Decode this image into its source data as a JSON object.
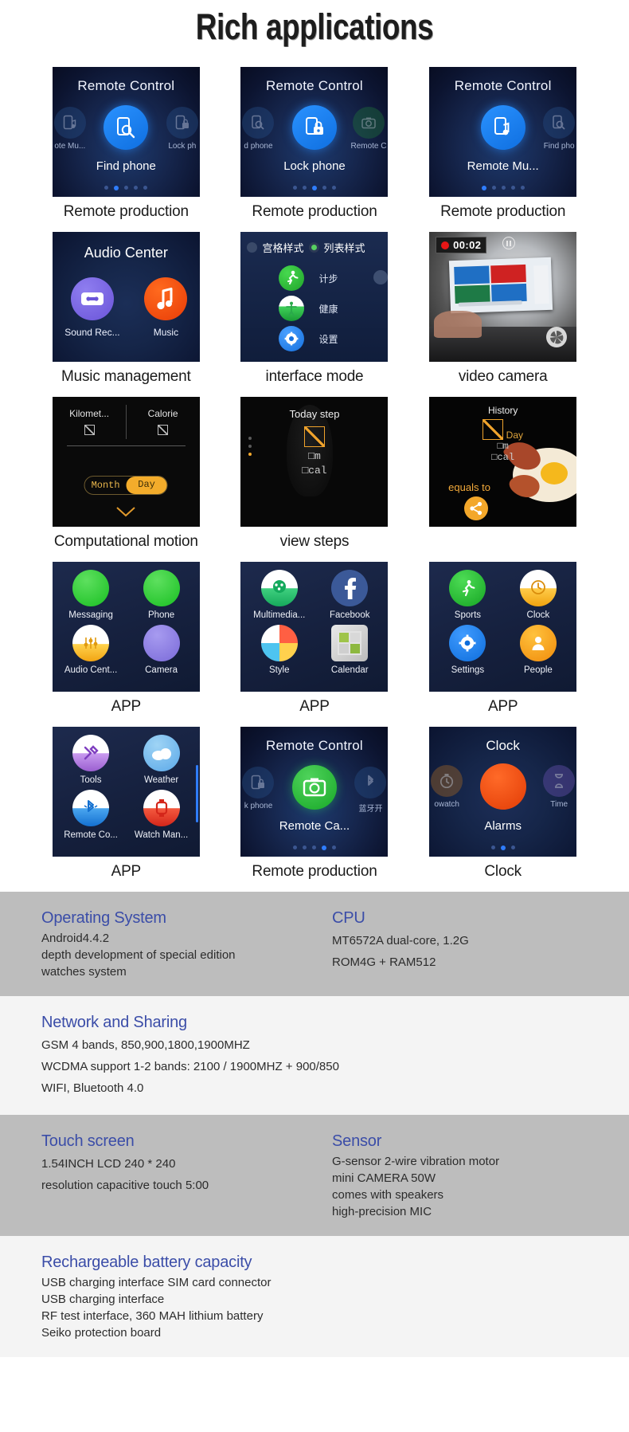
{
  "page": {
    "title": "Rich applications"
  },
  "cards": [
    {
      "caption": "Remote production",
      "screen_title": "Remote Control",
      "main_label": "Find phone",
      "left_label": "ote Mu...",
      "right_label": "Lock ph",
      "dots": 5,
      "active_dot": 2,
      "left_icon": "music-phone-icon",
      "main_icon": "find-phone-icon",
      "right_icon": "lock-phone-icon"
    },
    {
      "caption": "Remote production",
      "screen_title": "Remote Control",
      "main_label": "Lock phone",
      "left_label": "d phone",
      "right_label": "Remote C",
      "dots": 5,
      "active_dot": 3,
      "left_icon": "find-phone-icon",
      "main_icon": "lock-phone-icon",
      "right_icon": "remote-camera-icon"
    },
    {
      "caption": "Remote production",
      "screen_title": "Remote Control",
      "main_label": "Remote Mu...",
      "left_label": "",
      "right_label": "Find pho",
      "dots": 5,
      "active_dot": 1,
      "left_icon": "none-icon",
      "main_icon": "music-phone-icon",
      "right_icon": "find-phone-icon"
    },
    {
      "caption": "Music management",
      "screen_title": "Audio Center",
      "items": [
        {
          "label": "Sound Rec...",
          "icon": "cassette-icon"
        },
        {
          "label": "Music",
          "icon": "music-note-icon"
        }
      ]
    },
    {
      "caption": "interface mode",
      "radios": [
        {
          "label": "宫格样式",
          "selected": false
        },
        {
          "label": "列表样式",
          "selected": true
        }
      ],
      "rows": [
        {
          "label": "计步",
          "icon": "running-icon"
        },
        {
          "label": "健康",
          "icon": "health-icon"
        },
        {
          "label": "设置",
          "icon": "settings-gear-icon"
        }
      ]
    },
    {
      "caption": "video camera",
      "timer": "00:02",
      "rec_icon": "record-dot-icon",
      "pause_icon": "pause-icon",
      "shutter_icon": "shutter-icon"
    },
    {
      "caption": "Computational motion",
      "cols": [
        {
          "label": "Kilomet...",
          "value": "□"
        },
        {
          "label": "Calorie",
          "value": "□"
        }
      ],
      "toggle": [
        "Month",
        "Day"
      ],
      "toggle_active": "Day",
      "chevron": "chevron-down-icon"
    },
    {
      "caption": "view steps",
      "title": "Today step",
      "value": "□",
      "sub1": "□m",
      "sub2": "□cal"
    },
    {
      "caption": "",
      "title": "History",
      "day_label": "Day",
      "v1": "□",
      "v2": "□m",
      "v3": "□cal",
      "equals": "equals to",
      "share_icon": "share-icon"
    },
    {
      "caption": "APP",
      "apps": [
        {
          "label": "Messaging",
          "icon": "messaging-icon"
        },
        {
          "label": "Phone",
          "icon": "phone-icon"
        },
        {
          "label": "Audio Cent...",
          "icon": "audio-center-icon"
        },
        {
          "label": "Camera",
          "icon": "camera-icon"
        }
      ]
    },
    {
      "caption": "APP",
      "apps": [
        {
          "label": "Multimedia...",
          "icon": "multimedia-icon"
        },
        {
          "label": "Facebook",
          "icon": "facebook-icon"
        },
        {
          "label": "Style",
          "icon": "style-icon"
        },
        {
          "label": "Calendar",
          "icon": "calendar-icon"
        }
      ]
    },
    {
      "caption": "APP",
      "apps": [
        {
          "label": "Sports",
          "icon": "sports-icon"
        },
        {
          "label": "Clock",
          "icon": "clock-icon"
        },
        {
          "label": "Settings",
          "icon": "settings-icon"
        },
        {
          "label": "People",
          "icon": "people-icon"
        }
      ]
    },
    {
      "caption": "APP",
      "apps": [
        {
          "label": "Tools",
          "icon": "tools-icon"
        },
        {
          "label": "Weather",
          "icon": "weather-icon"
        },
        {
          "label": "Remote Co...",
          "icon": "bluetooth-icon"
        },
        {
          "label": "Watch Man...",
          "icon": "watch-manager-icon"
        }
      ]
    },
    {
      "caption": "Remote production",
      "screen_title": "Remote Control",
      "main_label": "Remote Ca...",
      "left_label": "k phone",
      "right_label": "蓝牙开",
      "dots": 5,
      "active_dot": 4,
      "left_icon": "lock-phone-icon",
      "main_icon": "remote-camera-icon",
      "right_icon": "bluetooth-icon"
    },
    {
      "caption": "Clock",
      "screen_title": "Clock",
      "main_label": "Alarms",
      "left_label": "owatch",
      "right_label": "Time",
      "dots": 3,
      "active_dot": 2,
      "left_icon": "stopwatch-icon",
      "main_icon": "alarm-icon",
      "right_icon": "timer-icon"
    }
  ],
  "specs": [
    {
      "shade": "grey",
      "left": {
        "heading": "Operating System",
        "lines": [
          "Android4.4.2",
          "depth development of special edition",
          "watches system"
        ]
      },
      "right": {
        "heading": "CPU",
        "lines": [
          "MT6572A dual-core, 1.2G",
          "ROM4G + RAM512"
        ]
      }
    },
    {
      "shade": "light",
      "left": {
        "heading": "Network and Sharing",
        "lines": [
          "GSM 4 bands, 850,900,1800,1900MHZ",
          "WCDMA support 1-2 bands: 2100 / 1900MHZ + 900/850",
          "WIFI, Bluetooth 4.0"
        ]
      },
      "right": {
        "heading": "",
        "lines": []
      }
    },
    {
      "shade": "grey",
      "left": {
        "heading": "Touch screen",
        "lines": [
          "1.54INCH LCD 240 * 240",
          "resolution capacitive touch 5:00"
        ]
      },
      "right": {
        "heading": "Sensor",
        "lines": [
          "G-sensor 2-wire vibration motor",
          "mini CAMERA 50W",
          "comes with speakers",
          "high-precision MIC"
        ]
      }
    },
    {
      "shade": "light",
      "left": {
        "heading": "Rechargeable battery capacity",
        "lines": [
          "USB charging interface SIM card connector",
          "USB charging interface",
          "RF test interface, 360 MAH lithium battery",
          "Seiko protection board"
        ]
      },
      "right": {
        "heading": "",
        "lines": []
      }
    }
  ],
  "colors": {
    "accent_blue": "#2f7dfd",
    "spec_heading": "#3b4da8",
    "orange": "#f3a72a",
    "green": "#19bf22",
    "red": "#e23c06"
  }
}
